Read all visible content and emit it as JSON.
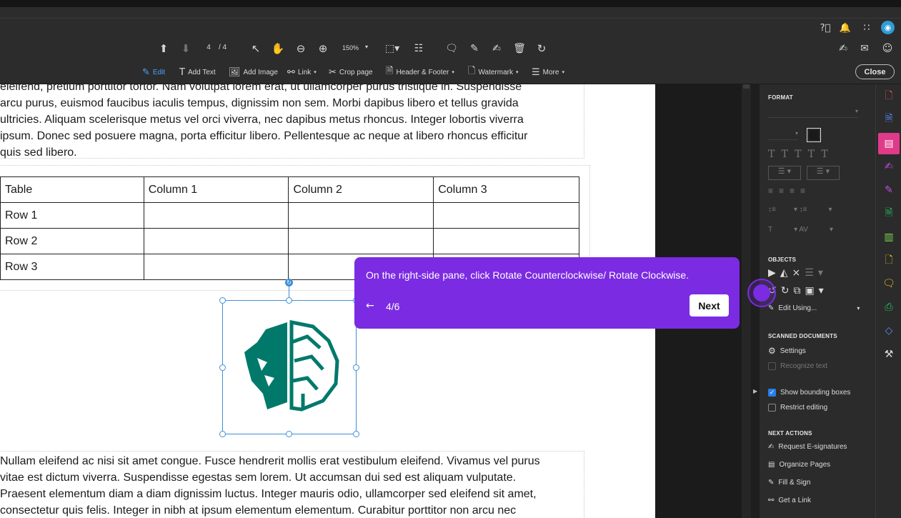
{
  "toolbar": {
    "page_current": "4",
    "page_total": "/ 4",
    "zoom": "150%"
  },
  "edit_toolbar": {
    "edit": "Edit",
    "add_text": "Add Text",
    "add_image": "Add Image",
    "link": "Link",
    "crop_page": "Crop page",
    "header_footer": "Header & Footer",
    "watermark": "Watermark",
    "more": "More",
    "close": "Close"
  },
  "document": {
    "para1_lines": [
      "eleifend, pretium porttitor tortor. Nam volutpat lorem erat, ut ullamcorper purus tristique in. Suspendisse",
      "arcu purus, euismod faucibus iaculis tempus, dignissim non sem. Morbi dapibus libero et tellus gravida",
      "ultricies. Aliquam scelerisque metus vel orci viverra, nec dapibus metus rhoncus. Integer lobortis viverra",
      "ipsum. Donec sed posuere magna, porta efficitur libero. Pellentesque ac neque at libero rhoncus efficitur",
      "quis sed libero."
    ],
    "table": {
      "headers": [
        "Table",
        "Column 1",
        "Column 2",
        "Column 3"
      ],
      "rows": [
        [
          "Row 1",
          "",
          "",
          ""
        ],
        [
          "Row 2",
          "",
          "",
          ""
        ],
        [
          "Row 3",
          "",
          "",
          ""
        ]
      ]
    },
    "para2_lines": [
      "Nullam eleifend ac nisi sit amet congue. Fusce hendrerit mollis erat vestibulum eleifend. Vivamus vel purus",
      "vitae est dictum viverra. Suspendisse egestas sem lorem. Ut accumsan dui sed est aliquam vulputate.",
      "Praesent elementum diam a diam dignissim luctus. Integer mauris odio, ullamcorper sed eleifend sit amet,",
      "consectetur quis felis. Integer in nibh at ipsum elementum elementum. Curabitur porttitor non arcu nec"
    ],
    "logo_color": "#00796b"
  },
  "format_panel": {
    "format_title": "FORMAT",
    "objects_title": "OBJECTS",
    "edit_using": "Edit Using...",
    "scanned_title": "SCANNED DOCUMENTS",
    "settings": "Settings",
    "recognize_text": "Recognize text",
    "show_bounding_boxes": "Show bounding boxes",
    "show_bounding_boxes_checked": true,
    "restrict_editing": "Restrict editing",
    "restrict_editing_checked": false,
    "next_actions_title": "NEXT ACTIONS",
    "next_actions": [
      "Request E-signatures",
      "Organize Pages",
      "Fill & Sign",
      "Get a Link"
    ]
  },
  "tooltip": {
    "message": "On the right-side pane, click Rotate Counterclockwise/ Rotate Clockwise.",
    "back_icon": "←",
    "step": "4/6",
    "next": "Next",
    "color": "#7b2be2"
  }
}
